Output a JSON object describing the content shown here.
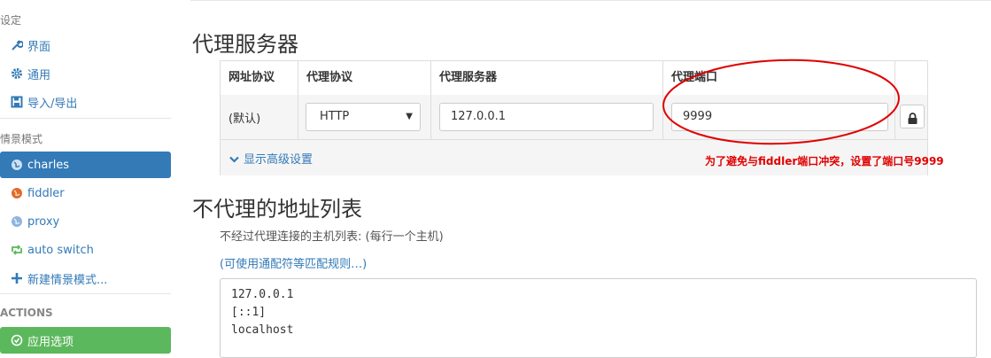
{
  "sidebar": {
    "settings_header": "设定",
    "items_settings": [
      {
        "label": "界面",
        "icon": "wrench-icon"
      },
      {
        "label": "通用",
        "icon": "gear-icon"
      },
      {
        "label": "导入/导出",
        "icon": "floppy-icon"
      }
    ],
    "profiles_header": "情景模式",
    "profiles": [
      {
        "label": "charles",
        "icon": "globe-icon",
        "color": "#ffffff",
        "active": true
      },
      {
        "label": "fiddler",
        "icon": "globe-icon",
        "color": "#e06b2c"
      },
      {
        "label": "proxy",
        "icon": "globe-icon",
        "color": "#8fb4e0"
      },
      {
        "label": "auto switch",
        "icon": "retweet-icon",
        "color": "#5cb85c"
      },
      {
        "label": "新建情景模式...",
        "icon": "plus-icon",
        "color": "#337ab7"
      }
    ],
    "actions_header": "ACTIONS",
    "apply_label": "应用选项"
  },
  "main": {
    "proxy_section_title": "代理服务器",
    "table": {
      "headers": [
        "网址协议",
        "代理协议",
        "代理服务器",
        "代理端口"
      ],
      "row": {
        "scheme": "(默认)",
        "protocol": "HTTP",
        "server": "127.0.0.1",
        "port": "9999"
      },
      "advanced_label": "显示高级设置"
    },
    "annotation": "为了避免与fiddler端口冲突，设置了端口号9999",
    "bypass_section_title": "不代理的地址列表",
    "bypass_help": "不经过代理连接的主机列表: (每行一个主机)",
    "bypass_link": "(可使用通配符等匹配规则…)",
    "bypass_list": "127.0.0.1\n[::1]\nlocalhost"
  },
  "colors": {
    "accent": "#337ab7",
    "apply_green": "#5cb85c",
    "annotation_red": "#e00000"
  }
}
